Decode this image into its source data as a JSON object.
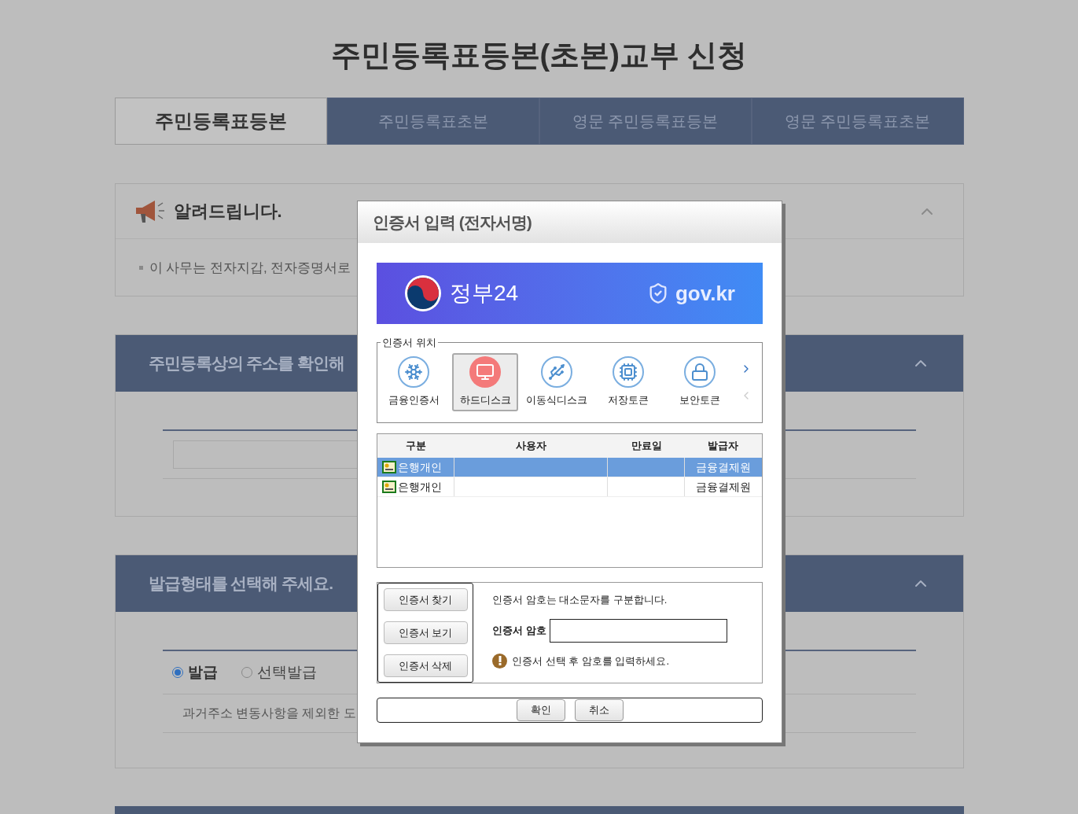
{
  "page": {
    "title": "주민등록표등본(초본)교부 신청",
    "tabs": [
      {
        "label": "주민등록표등본",
        "selected": true
      },
      {
        "label": "주민등록표초본",
        "selected": false
      },
      {
        "label": "영문 주민등록표등본",
        "selected": false
      },
      {
        "label": "영문 주민등록표초본",
        "selected": false
      }
    ],
    "notice": {
      "title": "알려드립니다.",
      "items": [
        "이 사무는 전자지갑, 전자증명서로"
      ]
    },
    "address_section": {
      "title": "주민등록상의 주소를 확인해"
    },
    "issue_section": {
      "title": "발급형태를 선택해 주세요.",
      "options": [
        {
          "label": "발급",
          "selected": true
        },
        {
          "label": "선택발급",
          "selected": false
        }
      ],
      "description": "과거주소 변동사항을 제외한 도"
    }
  },
  "dialog": {
    "title": "인증서 입력 (전자서명)",
    "banner": {
      "brand": "정부24",
      "domain": "gov.kr"
    },
    "location": {
      "legend": "인증서 위치",
      "items": [
        {
          "label": "금융인증서",
          "kind": "financial",
          "selected": false
        },
        {
          "label": "하드디스크",
          "kind": "harddisk",
          "selected": true
        },
        {
          "label": "이동식디스크",
          "kind": "removable",
          "selected": false
        },
        {
          "label": "저장토큰",
          "kind": "storage",
          "selected": false
        },
        {
          "label": "보안토큰",
          "kind": "security",
          "selected": false
        }
      ]
    },
    "cert_table": {
      "columns": [
        "구분",
        "사용자",
        "만료일",
        "발급자"
      ],
      "rows": [
        {
          "type": "은행개인",
          "issuer": "금융결제원",
          "selected": true
        },
        {
          "type": "은행개인",
          "issuer": "금융결제원",
          "selected": false
        }
      ]
    },
    "side_buttons": [
      "인증서 찾기",
      "인증서 보기",
      "인증서 삭제"
    ],
    "password": {
      "note": "인증서 암호는 대소문자를 구분합니다.",
      "label": "인증서 암호",
      "hint": "인증서 선택 후 암호를 입력하세요."
    },
    "buttons": [
      "확인",
      "취소"
    ]
  }
}
